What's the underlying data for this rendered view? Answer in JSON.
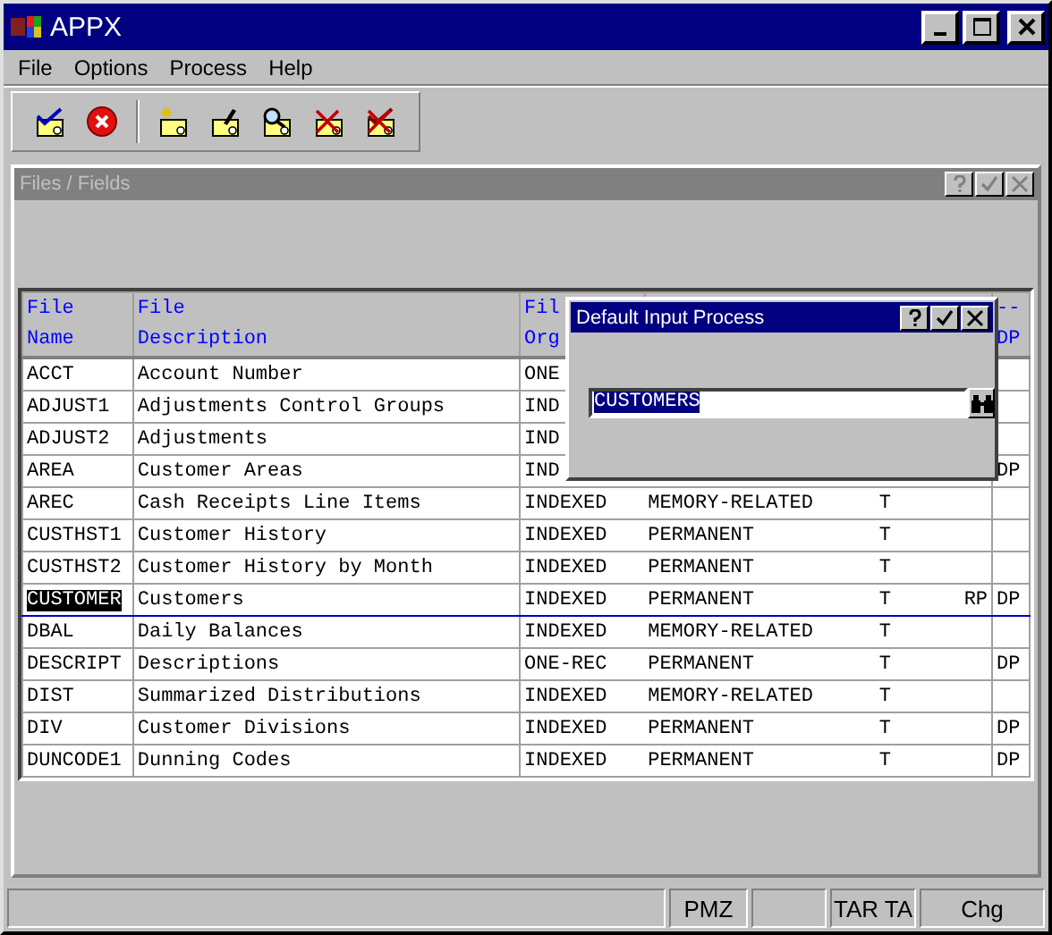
{
  "window": {
    "title": "APPX"
  },
  "menu": [
    "File",
    "Options",
    "Process",
    "Help"
  ],
  "toolbar": [
    {
      "kind": "check"
    },
    {
      "kind": "cancel"
    },
    {
      "kind": "new"
    },
    {
      "kind": "edit"
    },
    {
      "kind": "search"
    },
    {
      "kind": "delete"
    },
    {
      "kind": "delete-check"
    }
  ],
  "child_window": {
    "title": "Files / Fields"
  },
  "table": {
    "columns": [
      {
        "heading": [
          "File",
          "Name"
        ]
      },
      {
        "heading": [
          "File",
          "Description"
        ]
      },
      {
        "heading": [
          "Fil",
          "Org"
        ]
      },
      {},
      {},
      {},
      {
        "heading": [
          "--",
          "DP"
        ]
      }
    ],
    "rows": [
      {
        "selected": false,
        "cells": [
          "ACCT",
          "Account Number",
          "ONE",
          null,
          null,
          null,
          null
        ]
      },
      {
        "selected": false,
        "cells": [
          "ADJUST1",
          "Adjustments Control Groups",
          "IND",
          null,
          null,
          null,
          null
        ]
      },
      {
        "selected": false,
        "cells": [
          "ADJUST2",
          "Adjustments",
          "IND",
          null,
          null,
          null,
          null
        ]
      },
      {
        "selected": false,
        "cells": [
          "AREA",
          "Customer Areas",
          "IND",
          null,
          null,
          null,
          "DP"
        ]
      },
      {
        "selected": false,
        "cells": [
          "AREC",
          "Cash Receipts Line Items",
          "INDEXED",
          "MEMORY-RELATED",
          "T",
          null,
          null
        ]
      },
      {
        "selected": false,
        "cells": [
          "CUSTHST1",
          "Customer History",
          "INDEXED",
          "PERMANENT",
          "T",
          null,
          null
        ]
      },
      {
        "selected": false,
        "cells": [
          "CUSTHST2",
          "Customer History by Month",
          "INDEXED",
          "PERMANENT",
          "T",
          null,
          null
        ]
      },
      {
        "selected": true,
        "cells": [
          "CUSTOMER",
          "Customers",
          "INDEXED",
          "PERMANENT",
          "T",
          "RP",
          "DP"
        ]
      },
      {
        "selected": false,
        "cells": [
          "DBAL",
          "Daily Balances",
          "INDEXED",
          "MEMORY-RELATED",
          "T",
          null,
          null
        ]
      },
      {
        "selected": false,
        "cells": [
          "DESCRIPT",
          "Descriptions",
          "ONE-REC",
          "PERMANENT",
          "T",
          null,
          "DP"
        ]
      },
      {
        "selected": false,
        "cells": [
          "DIST",
          "Summarized Distributions",
          "INDEXED",
          "MEMORY-RELATED",
          "T",
          null,
          null
        ]
      },
      {
        "selected": false,
        "cells": [
          "DIV",
          "Customer Divisions",
          "INDEXED",
          "PERMANENT",
          "T",
          null,
          "DP"
        ]
      },
      {
        "selected": false,
        "cells": [
          "DUNCODE1",
          "Dunning Codes",
          "INDEXED",
          "PERMANENT",
          "T",
          null,
          "DP"
        ]
      }
    ]
  },
  "dialog": {
    "title": "Default Input Process",
    "field": {
      "value": "CUSTOMERS"
    }
  },
  "status_bar": {
    "panel_2": "PMZ",
    "panel_4": "TAR TA",
    "panel_5": "Chg"
  }
}
